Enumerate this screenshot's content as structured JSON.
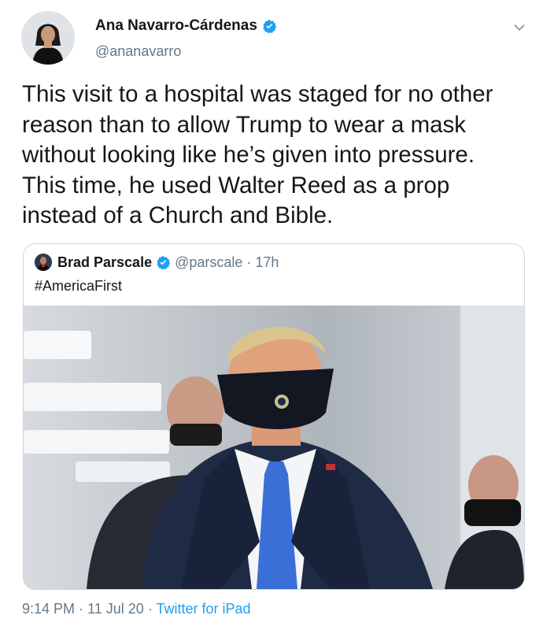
{
  "author": {
    "name": "Ana Navarro-Cárdenas",
    "handle": "@ananavarro",
    "verified": true
  },
  "icons": {
    "verified": "verified-badge-icon",
    "more": "chevron-down-icon"
  },
  "tweet": {
    "text": "This visit to a hospital was staged for no other\nreason than to allow Trump to wear a mask\nwithout looking like he’s given into pressure.\nThis time, he used Walter Reed as a prop\ninstead of a Church and Bible."
  },
  "quoted": {
    "name": "Brad Parscale",
    "handle": "@parscale",
    "separator": "·",
    "time": "17h",
    "text": "#AmericaFirst",
    "verified": true
  },
  "footer": {
    "time": "9:14 PM",
    "separator1": "·",
    "date": "11 Jul 20",
    "separator2": "·",
    "source": "Twitter for iPad"
  },
  "colors": {
    "text": "#14171a",
    "secondary": "#657786",
    "accent": "#1da1f2",
    "border": "#ccd6dd"
  }
}
